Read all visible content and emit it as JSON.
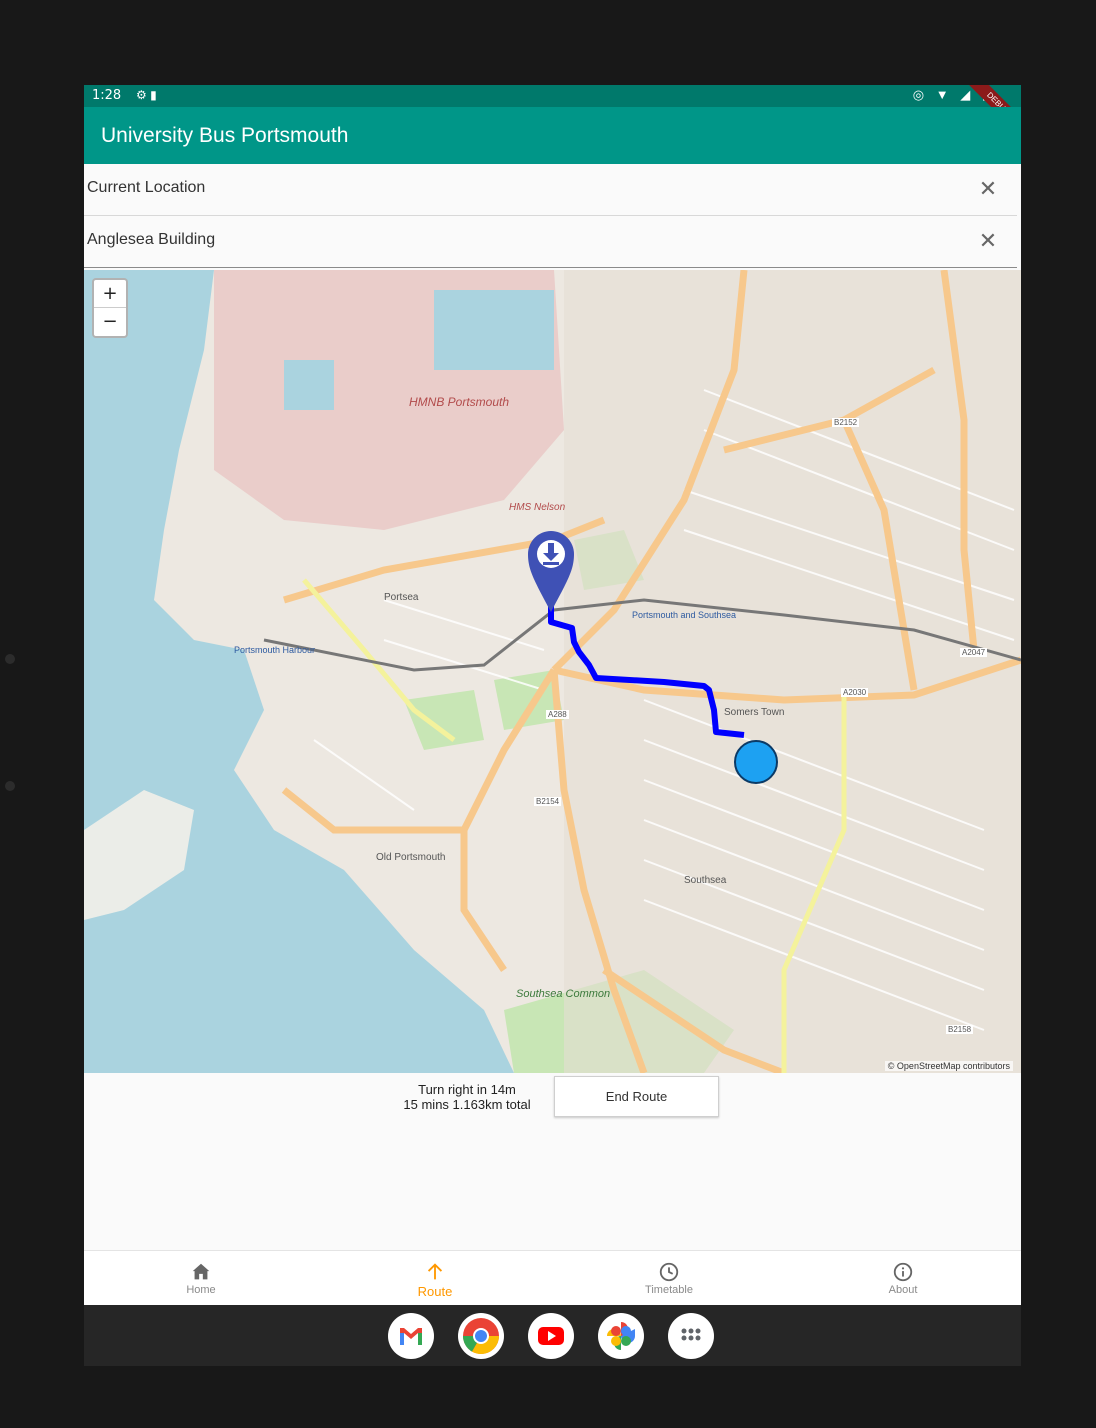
{
  "status_bar": {
    "time": "1:28",
    "left_icons": [
      "settings-icon",
      "sd-card-icon"
    ],
    "right_icons": [
      "location-icon",
      "wifi-icon",
      "signal-icon",
      "battery-icon"
    ],
    "debug_banner": "DEBUG"
  },
  "app_bar": {
    "title": "University Bus Portsmouth"
  },
  "origin_field": {
    "value": "Current Location",
    "clear_icon": "close-icon"
  },
  "destination_field": {
    "value": "Anglesea Building",
    "clear_icon": "close-icon"
  },
  "map": {
    "zoom_in_label": "+",
    "zoom_out_label": "−",
    "attribution": "© OpenStreetMap contributors",
    "route_color": "#0000ff",
    "current_location_color": "#1da1f2",
    "destination_marker_color": "#3f51b5",
    "labels": {
      "hmnb": "HMNB Portsmouth",
      "hms_nelson": "HMS Nelson",
      "portsea": "Portsea",
      "old_portsmouth": "Old Portsmouth",
      "southsea": "Southsea",
      "southsea_common": "Southsea Common",
      "portsmouth_harbour": "Portsmouth Harbour",
      "portsmouth_southsea": "Portsmouth and Southsea",
      "somers_town": "Somers Town",
      "a288": "A288",
      "a2030": "A2030",
      "b2154": "B2154",
      "b2152": "B2152",
      "a2047": "A2047",
      "b2158": "B2158"
    }
  },
  "route": {
    "instruction": "Turn right in 14m",
    "summary": "15 mins 1.163km total",
    "end_button": "End Route"
  },
  "bottom_nav": {
    "items": [
      {
        "label": "Home",
        "icon": "home-icon",
        "active": false
      },
      {
        "label": "Route",
        "icon": "arrow-up-icon",
        "active": true
      },
      {
        "label": "Timetable",
        "icon": "clock-icon",
        "active": false
      },
      {
        "label": "About",
        "icon": "info-icon",
        "active": false
      }
    ],
    "active_color": "#ff9800"
  },
  "dock": {
    "apps": [
      "gmail-icon",
      "chrome-icon",
      "youtube-icon",
      "photos-icon",
      "app-drawer-icon"
    ]
  }
}
